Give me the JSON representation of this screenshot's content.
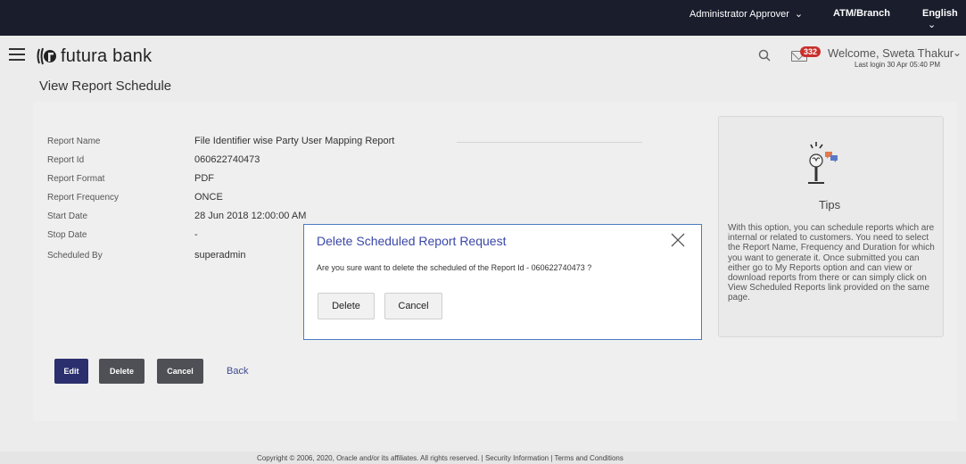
{
  "topbar": {
    "role": "Administrator Approver",
    "atm_branch": "ATM/Branch",
    "language": "English"
  },
  "header": {
    "brand": "futura bank",
    "notification_count": "332",
    "welcome": "Welcome, Sweta Thakur",
    "last_login": "Last login 30 Apr 05:40 PM"
  },
  "page": {
    "title": "View Report Schedule"
  },
  "details": [
    {
      "label": "Report Name",
      "value": "File Identifier wise Party User Mapping Report"
    },
    {
      "label": "Report Id",
      "value": "060622740473"
    },
    {
      "label": "Report Format",
      "value": "PDF"
    },
    {
      "label": "Report Frequency",
      "value": "ONCE"
    },
    {
      "label": "Start Date",
      "value": "28 Jun 2018 12:00:00 AM"
    },
    {
      "label": "Stop Date",
      "value": "-"
    },
    {
      "label": "Scheduled By",
      "value": "superadmin"
    }
  ],
  "tips": {
    "title": "Tips",
    "text": "With this option, you can schedule reports which are internal or related to customers. You need to select the Report Name, Frequency and Duration for which you want to generate it. Once submitted you can either go to My Reports option and can view or download reports from there or can simply click on View Scheduled Reports link provided on the same page."
  },
  "actions": {
    "edit": "Edit",
    "delete": "Delete",
    "cancel": "Cancel",
    "back": "Back"
  },
  "modal": {
    "title": "Delete Scheduled Report Request",
    "message": "Are you sure want to delete the scheduled of the Report Id - 060622740473 ?",
    "delete": "Delete",
    "cancel": "Cancel"
  },
  "footer": {
    "text": "Copyright © 2006, 2020, Oracle and/or its affiliates. All rights reserved. | Security Information | Terms and Conditions"
  },
  "colors": {
    "topbar": "#1a1d2c",
    "primary_button": "#2b2f6e",
    "secondary_button": "#4e5055",
    "modal_title": "#3a47a6",
    "badge": "#c9302c"
  }
}
